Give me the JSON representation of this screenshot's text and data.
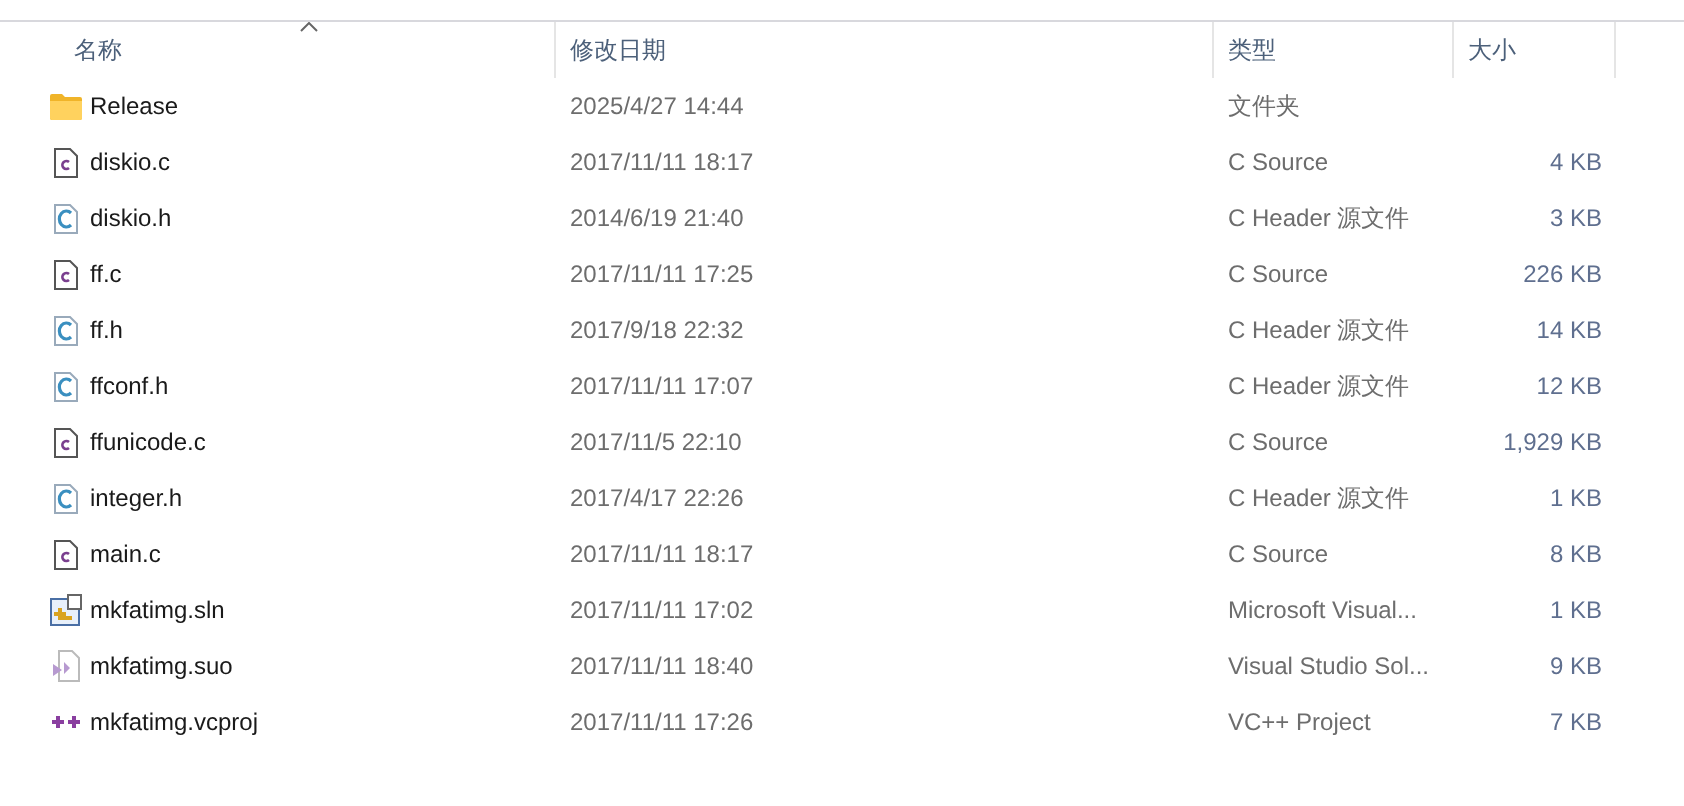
{
  "columns": [
    {
      "label": "名称",
      "sorted": true
    },
    {
      "label": "修改日期",
      "sorted": false
    },
    {
      "label": "类型",
      "sorted": false
    },
    {
      "label": "大小",
      "sorted": false
    }
  ],
  "files": [
    {
      "kind": "folder",
      "name": "Release",
      "date": "2025/4/27 14:44",
      "type": "文件夹"
    },
    {
      "kind": "c-source",
      "name": "diskio.c",
      "date": "2017/11/11 18:17",
      "type": "C Source",
      "size": "4 KB"
    },
    {
      "kind": "c-header",
      "name": "diskio.h",
      "date": "2014/6/19 21:40",
      "type": "C Header 源文件",
      "size": "3 KB"
    },
    {
      "kind": "c-source",
      "name": "ff.c",
      "date": "2017/11/11 17:25",
      "type": "C Source",
      "size": "226 KB"
    },
    {
      "kind": "c-header",
      "name": "ff.h",
      "date": "2017/9/18 22:32",
      "type": "C Header 源文件",
      "size": "14 KB"
    },
    {
      "kind": "c-header",
      "name": "ffconf.h",
      "date": "2017/11/11 17:07",
      "type": "C Header 源文件",
      "size": "12 KB"
    },
    {
      "kind": "c-source",
      "name": "ffunicode.c",
      "date": "2017/11/5 22:10",
      "type": "C Source",
      "size": "1,929 KB"
    },
    {
      "kind": "c-header",
      "name": "integer.h",
      "date": "2017/4/17 22:26",
      "type": "C Header 源文件",
      "size": "1 KB"
    },
    {
      "kind": "c-source",
      "name": "main.c",
      "date": "2017/11/11 18:17",
      "type": "C Source",
      "size": "8 KB"
    },
    {
      "kind": "solution",
      "name": "mkfatimg.sln",
      "date": "2017/11/11 17:02",
      "type": "Microsoft Visual...",
      "size": "1 KB"
    },
    {
      "kind": "suo",
      "name": "mkfatimg.suo",
      "date": "2017/11/11 18:40",
      "type": "Visual Studio Sol...",
      "size": "9 KB"
    },
    {
      "kind": "vcproj",
      "name": "mkfatimg.vcproj",
      "date": "2017/11/11 17:26",
      "type": "VC++ Project",
      "size": "7 KB"
    }
  ]
}
